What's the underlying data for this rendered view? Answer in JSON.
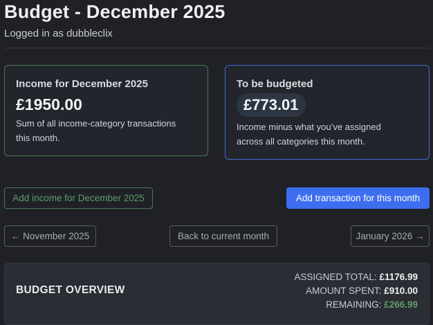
{
  "header": {
    "title": "Budget - December 2025",
    "subtitle": "Logged in as dubbleclix"
  },
  "income_card": {
    "label": "Income for December 2025",
    "value": "£1950.00",
    "description_line1": "Sum of all income-category transactions",
    "description_line2": "this month."
  },
  "budget_card": {
    "label": "To be budgeted",
    "value": "£773.01",
    "description_line1": "Income minus what you’ve assigned",
    "description_line2": "across all categories this month."
  },
  "actions": {
    "add_income_label": "Add income for December 2025",
    "add_transaction_label": "Add transaction for this month"
  },
  "nav": {
    "prev_label": "← November 2025",
    "current_label": "Back to current month",
    "next_label": "January 2026 →"
  },
  "overview": {
    "title": "BUDGET OVERVIEW",
    "assigned_label": "ASSIGNED TOTAL:",
    "assigned_value": "£1176.99",
    "spent_label": "AMOUNT SPENT:",
    "spent_value": "£910.00",
    "remaining_label": "REMAINING:",
    "remaining_value": "£266.99"
  },
  "colors": {
    "background": "#1f2126",
    "income_border": "#4c7a55",
    "budget_border": "#3e6bd0",
    "primary_button": "#3d6ef0",
    "positive_green": "#5e9d69"
  }
}
